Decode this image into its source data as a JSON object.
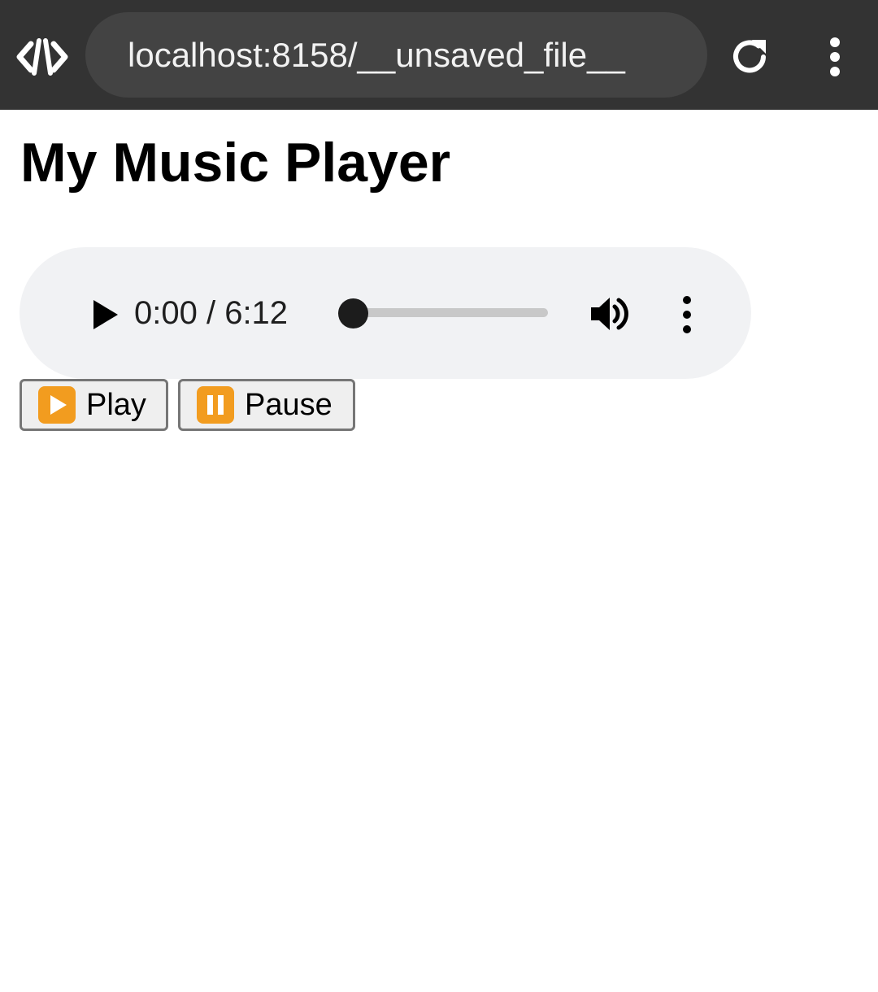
{
  "browser": {
    "url": "localhost:8158/__unsaved_file__",
    "logo_icon": "code-brackets-logo-icon",
    "reload_icon": "reload-icon",
    "menu_icon": "vertical-dots-icon",
    "colors": {
      "toolbar": "#333333",
      "urlbar": "#434343",
      "text": "#f2f2f2"
    }
  },
  "page": {
    "title": "My Music Player"
  },
  "audio_player": {
    "time_display": "0:00 / 6:12",
    "progress_fraction": 0.0,
    "play_icon": "play-icon",
    "volume_icon": "volume-icon",
    "options_icon": "vertical-dots-icon",
    "colors": {
      "background": "#f1f2f4",
      "track": "#c8c8c8",
      "thumb": "#1c1c1c"
    }
  },
  "controls": {
    "play_label": "Play",
    "play_icon": "play-emoji-icon",
    "pause_label": "Pause",
    "pause_icon": "pause-emoji-icon",
    "emoji_color": "#f29c1f"
  }
}
